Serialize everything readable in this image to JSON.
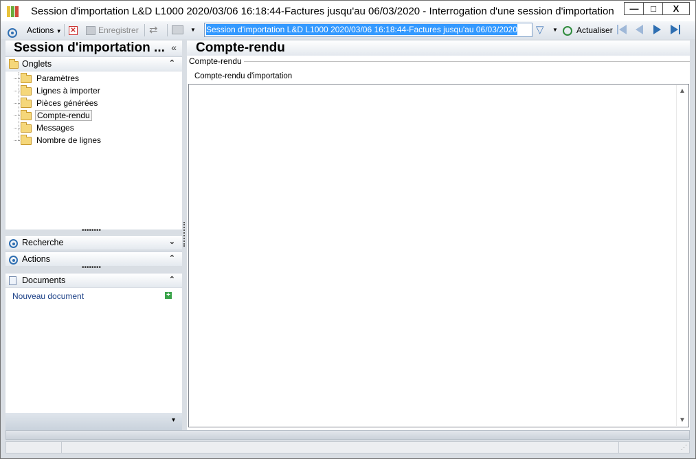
{
  "window": {
    "title": "Session d'importation L&D L1000 2020/03/06 16:18:44-Factures jusqu'au 06/03/2020 -  Interrogation d'une session d'importation",
    "minimize": "—",
    "maximize": "□",
    "close": "X"
  },
  "toolbar": {
    "actions_label": "Actions",
    "save_label": "Enregistrer",
    "search_value": "Session d'importation L&D L1000 2020/03/06 16:18:44-Factures jusqu'au 06/03/2020",
    "refresh_label": "Actualiser"
  },
  "left_panel": {
    "title": "Session d'importation ...",
    "collapse": "«",
    "tabs_section": {
      "label": "Onglets",
      "chevron": "⌃",
      "items": [
        {
          "label": "Paramètres",
          "selected": false
        },
        {
          "label": "Lignes à importer",
          "selected": false
        },
        {
          "label": "Pièces générées",
          "selected": false
        },
        {
          "label": "Compte-rendu",
          "selected": true
        },
        {
          "label": "Messages",
          "selected": false
        },
        {
          "label": "Nombre de lignes",
          "selected": false
        }
      ]
    },
    "search_section": {
      "label": "Recherche",
      "chevron": "⌄"
    },
    "actions_section": {
      "label": "Actions",
      "chevron": "⌃"
    },
    "documents_section": {
      "label": "Documents",
      "chevron": "⌃",
      "new_document": "Nouveau document"
    },
    "footer_chevron": "▾"
  },
  "main": {
    "title": "Compte-rendu",
    "group_caption": "Compte-rendu",
    "field_label": "Compte-rendu d'importation",
    "field_value": ""
  },
  "colors": {
    "accent": "#2f6fb2",
    "selection": "#3399ff",
    "panel_bg": "#d9dee4",
    "folder": "#f5d77a",
    "link": "#1a3f86"
  }
}
